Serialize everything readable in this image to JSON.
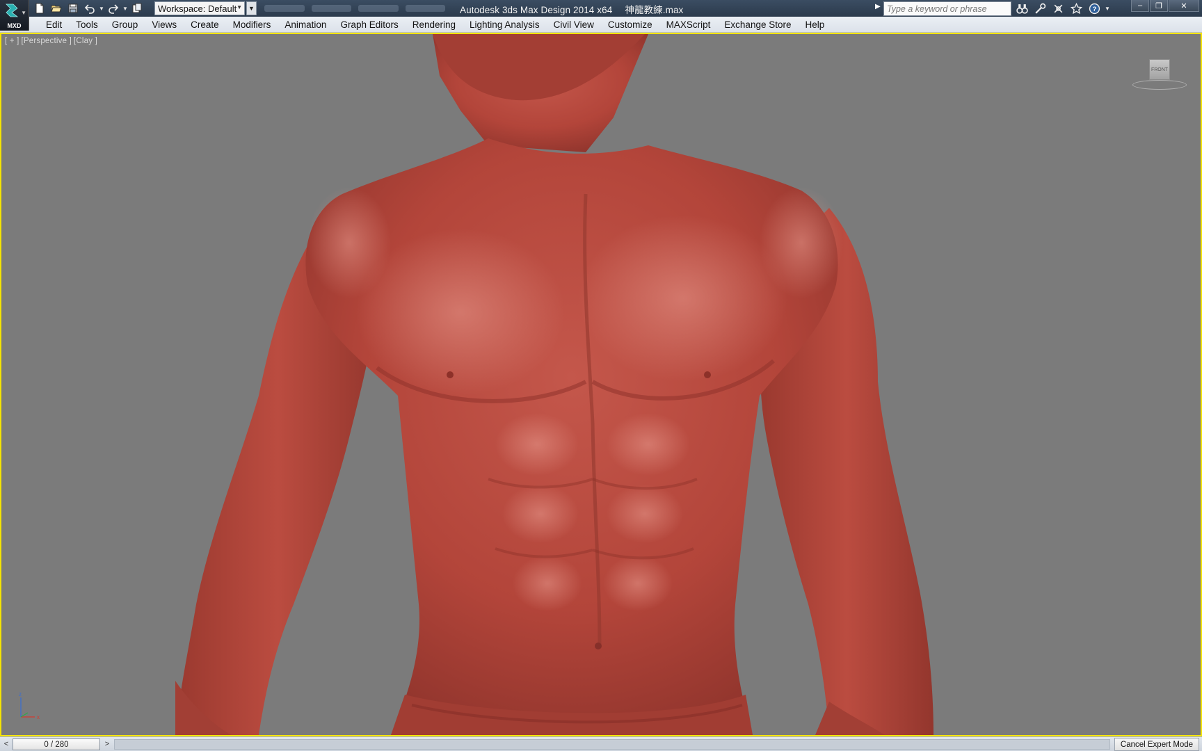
{
  "app": {
    "logo_caption": "MXD",
    "title": "Autodesk 3ds Max Design 2014 x64",
    "file_name": "神龍教練.max"
  },
  "quick_access": {
    "icons": [
      "new-file-icon",
      "open-file-icon",
      "save-icon",
      "undo-icon",
      "redo-icon",
      "project-folder-icon"
    ],
    "workspace_label": "Workspace: Default"
  },
  "search": {
    "placeholder": "Type a keyword or phrase"
  },
  "help_tools": {
    "icons": [
      "binoculars-icon",
      "tools-icon",
      "communication-icon",
      "favorites-star-icon",
      "help-icon"
    ]
  },
  "window_controls": {
    "minimize": "–",
    "restore": "❐",
    "close": "✕"
  },
  "menu": {
    "items": [
      "Edit",
      "Tools",
      "Group",
      "Views",
      "Create",
      "Modifiers",
      "Animation",
      "Graph Editors",
      "Rendering",
      "Lighting Analysis",
      "Civil View",
      "Customize",
      "MAXScript",
      "Exchange Store",
      "Help"
    ]
  },
  "viewport": {
    "label_plus": "[ + ]",
    "label_view": "[Perspective ]",
    "label_shading": "[Clay ]",
    "viewcube_face": "FRONT",
    "axis_z": "z",
    "axis_x": "x",
    "border_color": "#f5e400",
    "background_color": "#7b7b7b",
    "model_color": "#b3453a"
  },
  "statusbar": {
    "prev": "<",
    "time_slider": "0 / 280",
    "next": ">",
    "cancel_expert_mode": "Cancel Expert Mode"
  }
}
